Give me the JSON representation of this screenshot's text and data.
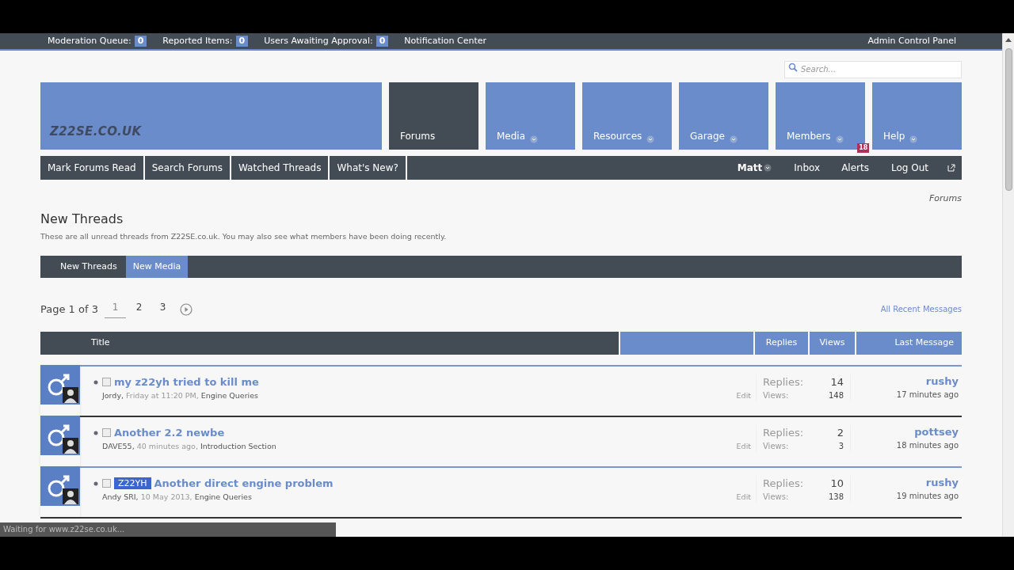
{
  "admin_bar": {
    "counters": [
      {
        "label": "Moderation Queue:",
        "count": "0"
      },
      {
        "label": "Reported Items:",
        "count": "0"
      },
      {
        "label": "Users Awaiting Approval:",
        "count": "0"
      }
    ],
    "notification_center": "Notification Center",
    "admin_control_panel": "Admin Control Panel"
  },
  "search": {
    "placeholder": "Search..."
  },
  "logo": "Z22SE.CO.UK",
  "nav_tabs": [
    {
      "label": "Forums",
      "selected": true
    },
    {
      "label": "Media",
      "selected": false
    },
    {
      "label": "Resources",
      "selected": false
    },
    {
      "label": "Garage",
      "selected": false
    },
    {
      "label": "Members",
      "selected": false
    },
    {
      "label": "Help",
      "selected": false
    }
  ],
  "sub_nav": {
    "links": [
      "Mark Forums Read",
      "Search Forums",
      "Watched Threads",
      "What's New?"
    ],
    "user": "Matt",
    "inbox": "Inbox",
    "alerts": "Alerts",
    "alerts_count": "18",
    "log_out": "Log Out"
  },
  "breadcrumb": "Forums",
  "heading": "New Threads",
  "description": "These are all unread threads from Z22SE.co.uk. You may also see what members have been doing recently.",
  "tabs": [
    {
      "label": "New Threads",
      "selected": false
    },
    {
      "label": "New Media",
      "selected": true
    }
  ],
  "pagination": {
    "label": "Page 1 of 3",
    "pages": [
      {
        "label": "1",
        "selected": true
      },
      {
        "label": "2",
        "selected": false
      },
      {
        "label": "3",
        "selected": false
      }
    ]
  },
  "all_recent": "All Recent Messages",
  "columns": {
    "title": "Title",
    "replies": "Replies",
    "views": "Views",
    "last_message": "Last Message"
  },
  "threads": [
    {
      "checked": false,
      "title": "my z22yh tried to kill me",
      "author": "Jordy,",
      "date": "Friday at 11:20 PM,",
      "forum": "Engine Queries",
      "edit": "Edit",
      "replies_label": "Replies:",
      "replies": "14",
      "views_label": "Views:",
      "views": "148",
      "last_user": "rushy",
      "last_time": "17 minutes ago"
    },
    {
      "checked": false,
      "title": "Another 2.2 newbe",
      "author": "DAVE55,",
      "date": "40 minutes ago,",
      "forum": "Introduction Section",
      "edit": "Edit",
      "replies_label": "Replies:",
      "replies": "2",
      "views_label": "Views:",
      "views": "3",
      "last_user": "pottsey",
      "last_time": "18 minutes ago"
    },
    {
      "checked": false,
      "prefix": "Z22YH",
      "title": "Another direct engine problem",
      "author": "Andy SRI,",
      "date": "10 May 2013,",
      "forum": "Engine Queries",
      "edit": "Edit",
      "replies_label": "Replies:",
      "replies": "10",
      "views_label": "Views:",
      "views": "138",
      "last_user": "rushy",
      "last_time": "19 minutes ago"
    }
  ],
  "status_bar": "Waiting for www.z22se.co.uk..."
}
